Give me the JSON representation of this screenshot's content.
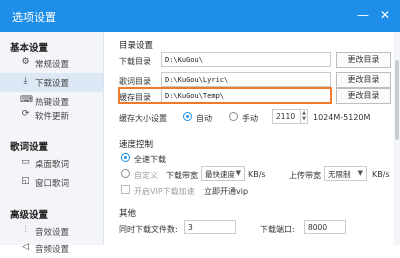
{
  "window": {
    "title": "选项设置",
    "minimize_label": "—",
    "close_label": "✕"
  },
  "sidebar": {
    "sections": [
      {
        "title": "基本设置",
        "items": [
          "常规设置",
          "下载设置",
          "热键设置",
          "软件更新"
        ]
      },
      {
        "title": "歌词设置",
        "items": [
          "桌面歌词",
          "窗口歌词"
        ]
      },
      {
        "title": "高级设置",
        "items": [
          "音效设置",
          "音频设置"
        ]
      }
    ],
    "active_item": "下载设置"
  },
  "dirs": {
    "group_title": "目录设置",
    "rows": [
      {
        "label": "下载目录",
        "path": "D:\\KuGou\\",
        "button": "更改目录"
      },
      {
        "label": "歌词目录",
        "path": "D:\\KuGou\\Lyric\\",
        "button": "更改目录"
      },
      {
        "label": "缓存目录",
        "path": "D:\\KuGou\\Temp\\",
        "button": "更改目录"
      }
    ],
    "cache_size_label": "缓存大小设置",
    "auto_label": "自动",
    "manual_label": "手动",
    "cache_value": "2110",
    "cache_range": "1024M-5120M",
    "mode_selected": "自动"
  },
  "speed": {
    "group_title": "速度控制",
    "full_speed_label": "全速下载",
    "custom_label": "自定义",
    "download_bw_label": "下载带宽",
    "download_bw_value": "最快速度",
    "kbs": "KB/s",
    "upload_bw_label": "上传带宽",
    "upload_bw_value": "无限制",
    "vip_label": "开启VIP下载加速",
    "vip_link": "立即开通vip",
    "mode_selected": "全速下载"
  },
  "other": {
    "group_title": "其他",
    "concurrent_label": "同时下载文件数:",
    "concurrent_value": "3",
    "port_label": "下载端口:",
    "port_value": "8000"
  },
  "colors": {
    "titlebar": "#1f8ee8",
    "highlight": "#f07a2a",
    "active_item_bg": "#dce8f6"
  }
}
